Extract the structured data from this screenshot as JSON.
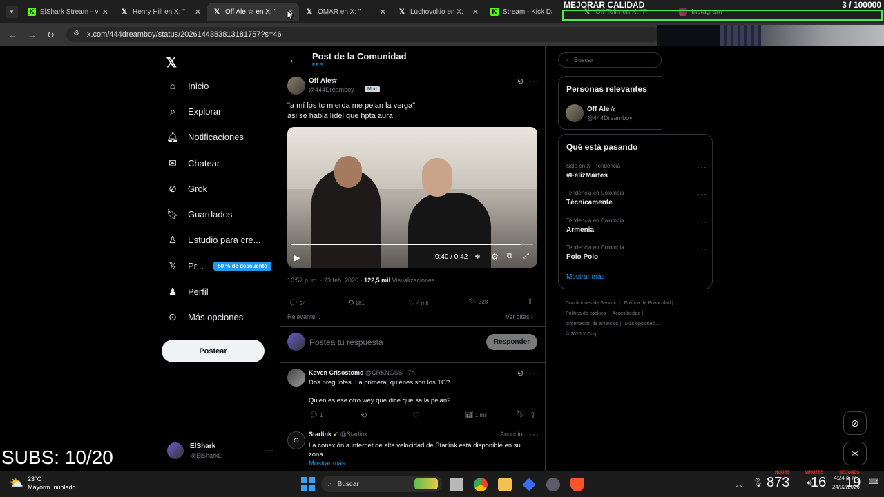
{
  "browser": {
    "tabs": [
      {
        "label": "ElShark Stream - V",
        "icon": "kick-icon"
      },
      {
        "label": "Henry Hill en X: \"",
        "icon": "x-icon"
      },
      {
        "label": "Off Ale ☆ en X: \"",
        "icon": "x-icon"
      },
      {
        "label": "OMAR en X: \"",
        "icon": "x-icon"
      },
      {
        "label": "Luchovoltio en X:",
        "icon": "x-icon"
      },
      {
        "label": "Stream - Kick Das",
        "icon": "kick-icon"
      },
      {
        "label": "Off Tolin en X: \"P",
        "icon": "x-icon"
      },
      {
        "label": "Instagram",
        "icon": "instagram-icon"
      }
    ],
    "url": "x.com/444dreamboy/status/2026144383813181757?s=46"
  },
  "stream_overlay": {
    "quality_label": "MEJORAR CALIDAD",
    "quality_count": "3 / 100000",
    "subs_label": "SUBS: 10/20"
  },
  "sidebar": {
    "items": [
      {
        "label": "Inicio",
        "icon": "home-icon"
      },
      {
        "label": "Explorar",
        "icon": "search-icon"
      },
      {
        "label": "Notificaciones",
        "icon": "bell-icon"
      },
      {
        "label": "Chatear",
        "icon": "mail-icon"
      },
      {
        "label": "Grok",
        "icon": "grok-icon"
      },
      {
        "label": "Guardados",
        "icon": "bookmark-icon"
      },
      {
        "label": "Estudio para cre...",
        "icon": "studio-icon"
      },
      {
        "label": "Pr...",
        "icon": "x-icon"
      },
      {
        "label": "Perfil",
        "icon": "person-icon"
      },
      {
        "label": "Más opciones",
        "icon": "more-circle-icon"
      }
    ],
    "premium_badge": "50 % de descuento",
    "post_button": "Postear",
    "account": {
      "name": "ElShark",
      "handle": "@ElSharkL"
    }
  },
  "main": {
    "header_title": "Post de la Comunidad",
    "header_subtitle": "FES",
    "post": {
      "author": "Off Ale☆",
      "handle": "@444Dreamboy",
      "badge": "Mod",
      "text_line1": "\"a mí los tc mierda me pelan la verga\"",
      "text_line2": "asi se habla lídel que hpta aura",
      "video_time": "0:40 / 0:42",
      "video_progress": 0.952,
      "timestamp": "10:57 p. m. · 23 feb. 2026 ·",
      "views_count": "122,5 mil",
      "views_label": "Visualizaciones",
      "stats": {
        "replies": "24",
        "reposts": "181",
        "likes": "4 mil",
        "bookmarks": "328"
      },
      "sort_label": "Relevante",
      "quotes_label": "Ver citas"
    },
    "reply_box": {
      "placeholder": "Postea tu respuesta",
      "button": "Responder"
    },
    "replies": [
      {
        "author": "Keven Crisostomo",
        "handle": "@CRKNGSS · 7h",
        "line1": "Dos preguntas. La primera, quiénes son los TC?",
        "line2": "Quien es ese otro wey que dice que se la pelan?",
        "stats": {
          "replies": "1",
          "views": "1 mil"
        }
      },
      {
        "author": "Starlink",
        "handle": "@Starlink",
        "tag": "Anuncio",
        "line1": "La conexión a internet de alta velocidad de Starlink está disponible en su",
        "line2": "zona....",
        "more": "Mostrar más"
      }
    ]
  },
  "right": {
    "search_placeholder": "Buscar",
    "relevant_title": "Personas relevantes",
    "relevant_person": {
      "name": "Off Ale☆",
      "handle": "@444Dreamboy"
    },
    "trending_title": "Qué está pasando",
    "trends": [
      {
        "category": "Solo en X · Tendencia",
        "name": "#FelizMartes"
      },
      {
        "category": "Tendencia en Colombia",
        "name": "Técnicamente"
      },
      {
        "category": "Tendencia en Colombia",
        "name": "Armenia"
      },
      {
        "category": "Tendencia en Colombia",
        "name": "Polo Polo"
      }
    ],
    "show_more": "Mostrar más",
    "footer_links": [
      "Condiciones de Servicio",
      "Política de Privacidad",
      "Política de cookies",
      "Accesibilidad",
      "Información de anuncios",
      "Más opciones ..."
    ],
    "copyright": "© 2026 X Corp."
  },
  "taskbar": {
    "weather_temp": "23°C",
    "weather_desc": "Mayorm. nublado",
    "search_label": "Buscar",
    "time": "4:24 p. m.",
    "date": "24/02/2026",
    "counter_left": "873",
    "counter_mid": "16",
    "counter_right": "19",
    "timer_labels": [
      "HOURS",
      "MINUTES",
      "SECONDS"
    ]
  }
}
